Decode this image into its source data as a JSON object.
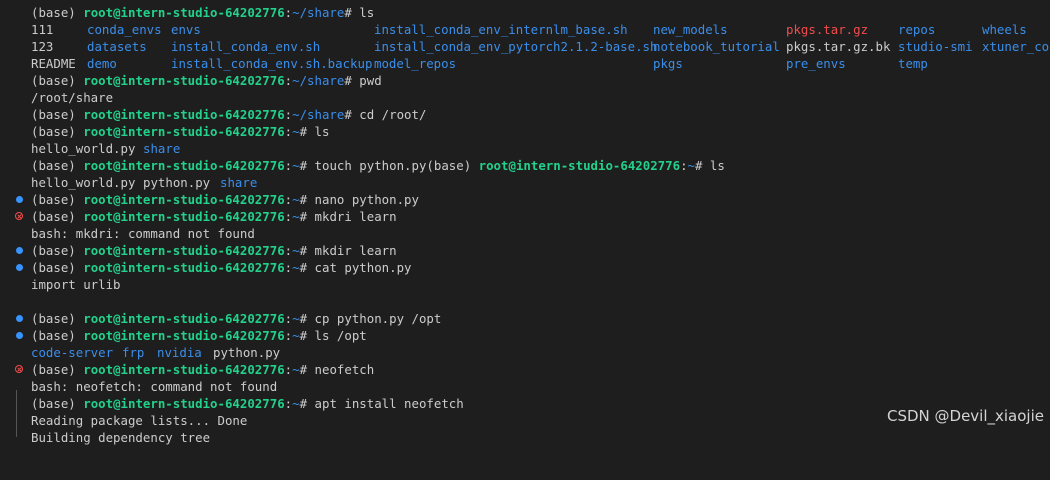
{
  "prompt": {
    "env": "(base)",
    "user_host": "root@intern-studio-64202776",
    "colon": ":",
    "dir_share": "~/share",
    "dir_home": "~",
    "hash": "#"
  },
  "ls_share": {
    "row1": [
      {
        "text": "111",
        "kind": "plain"
      },
      {
        "text": "conda_envs",
        "kind": "dir"
      },
      {
        "text": "envs",
        "kind": "dir"
      },
      {
        "text": "install_conda_env_internlm_base.sh",
        "kind": "dir"
      },
      {
        "text": "new_models",
        "kind": "dir"
      },
      {
        "text": "pkgs.tar.gz",
        "kind": "arch"
      },
      {
        "text": "repos",
        "kind": "dir"
      },
      {
        "text": "wheels",
        "kind": "dir"
      }
    ],
    "row2": [
      {
        "text": "123",
        "kind": "plain"
      },
      {
        "text": "datasets",
        "kind": "dir"
      },
      {
        "text": "install_conda_env.sh",
        "kind": "dir"
      },
      {
        "text": "install_conda_env_pytorch2.1.2-base.sh",
        "kind": "dir"
      },
      {
        "text": "notebook_tutorial",
        "kind": "dir"
      },
      {
        "text": "pkgs.tar.gz.bk",
        "kind": "plain"
      },
      {
        "text": "studio-smi",
        "kind": "dir"
      },
      {
        "text": "xtuner_cor",
        "kind": "dir"
      }
    ],
    "row3": [
      {
        "text": "README",
        "kind": "plain"
      },
      {
        "text": "demo",
        "kind": "dir"
      },
      {
        "text": "install_conda_env.sh.backup",
        "kind": "dir"
      },
      {
        "text": "model_repos",
        "kind": "dir"
      },
      {
        "text": "pkgs",
        "kind": "dir"
      },
      {
        "text": "pre_envs",
        "kind": "dir"
      },
      {
        "text": "temp",
        "kind": "dir"
      }
    ]
  },
  "lines": {
    "cmd_ls": " ls",
    "cmd_pwd": " pwd",
    "out_pwd": "/root/share",
    "cmd_cd": " cd /root/",
    "cmd_ls2": " ls",
    "out_ls2_file": "hello_world.py",
    "out_ls2_dir": "share",
    "cmd_touch": " touch python.py(base) ",
    "cmd_touch_tail": " ls",
    "out_ls3_f1": "hello_world.py",
    "out_ls3_f2": "python.py",
    "out_ls3_dir": "share",
    "cmd_nano": " nano python.py",
    "cmd_mkdri": " mkdri learn",
    "out_mkdri": "bash: mkdri: command not found",
    "cmd_mkdir": " mkdir learn",
    "cmd_cat": " cat python.py",
    "out_cat": "import urlib",
    "cmd_cp": " cp python.py /opt",
    "cmd_lsopt": " ls /opt",
    "out_opt_1": "code-server",
    "out_opt_2": "frp",
    "out_opt_3": "nvidia",
    "out_opt_4": "python.py",
    "cmd_neofetch": " neofetch",
    "out_neofetch": "bash: neofetch: command not found",
    "cmd_apt": " apt install neofetch",
    "out_apt_1": "Reading package lists... Done",
    "out_apt_2": "Building dependency tree"
  },
  "watermark": "CSDN @Devil_xiaojie",
  "colors": {
    "background": "#1e1e1e",
    "prompt_user": "#23d18b",
    "prompt_dir": "#3b8eea",
    "error_marker": "#f14c4c",
    "success_marker": "#3794ff"
  }
}
